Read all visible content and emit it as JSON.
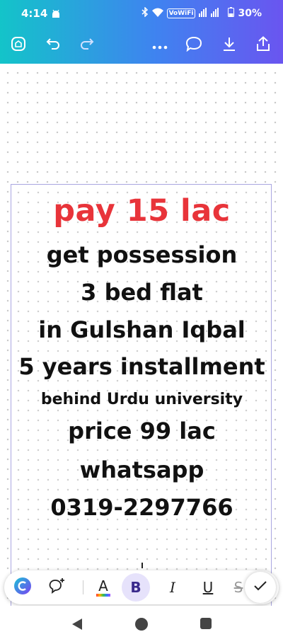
{
  "status": {
    "time": "4:14",
    "network_label": "VoWiFi",
    "battery": "30%"
  },
  "toolbar": {
    "icons": [
      "home-icon",
      "undo-icon",
      "redo-icon",
      "more-icon",
      "comment-icon",
      "download-icon",
      "share-icon"
    ]
  },
  "flyer": {
    "headline": "pay 15 lac",
    "lines": [
      "get possession",
      "3 bed flat",
      "in Gulshan Iqbal",
      "5 years installment",
      "behind Urdu university",
      "price 99 lac",
      "whatsapp",
      "0319-2297766"
    ],
    "headline_color": "#e8343a",
    "text_color": "#111111"
  },
  "format_toolbar": {
    "text_color_label": "A",
    "bold_label": "B",
    "italic_label": "I",
    "underline_label": "U",
    "strike_label": "S"
  },
  "colors": {
    "header_gradient_start": "#13c4c9",
    "header_gradient_end": "#6a55f0",
    "bold_active_bg": "#e6e2fb"
  }
}
